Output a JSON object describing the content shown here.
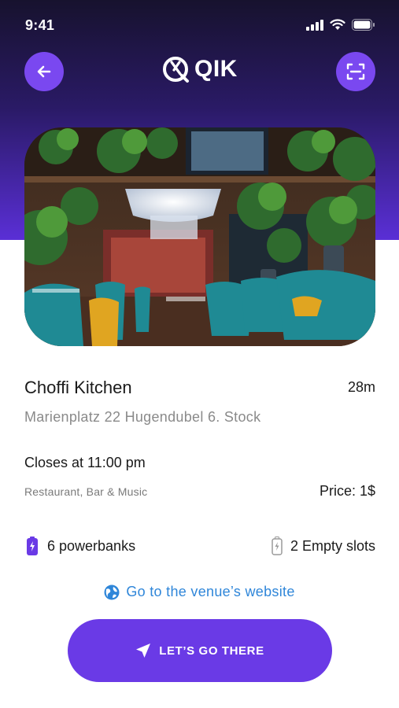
{
  "status_bar": {
    "time": "9:41"
  },
  "header": {
    "brand": "QIK"
  },
  "venue": {
    "name": "Choffi Kitchen",
    "distance": "28m",
    "address": "Marienplatz 22 Hugendubel 6. Stock",
    "closes": "Closes at 11:00 pm",
    "type": "Restaurant, Bar & Music",
    "price": "Price: 1$"
  },
  "stats": {
    "powerbanks": "6 powerbanks",
    "empty_slots": "2 Empty slots"
  },
  "website_link": "Go to the venue’s website",
  "cta": {
    "label": "LET’S GO THERE"
  },
  "colors": {
    "accent": "#6a3ae6",
    "button_purple": "#7a48f0",
    "header_dark": "#17122e",
    "link_blue": "#2f86d9",
    "battery_purple": "#6a3ae6"
  },
  "icons": [
    "back-arrow-icon",
    "scan-icon",
    "qik-logo-icon",
    "battery-icon",
    "empty-battery-icon",
    "globe-icon",
    "navigation-arrow-icon",
    "signal-icon",
    "wifi-icon",
    "status-battery-icon"
  ]
}
